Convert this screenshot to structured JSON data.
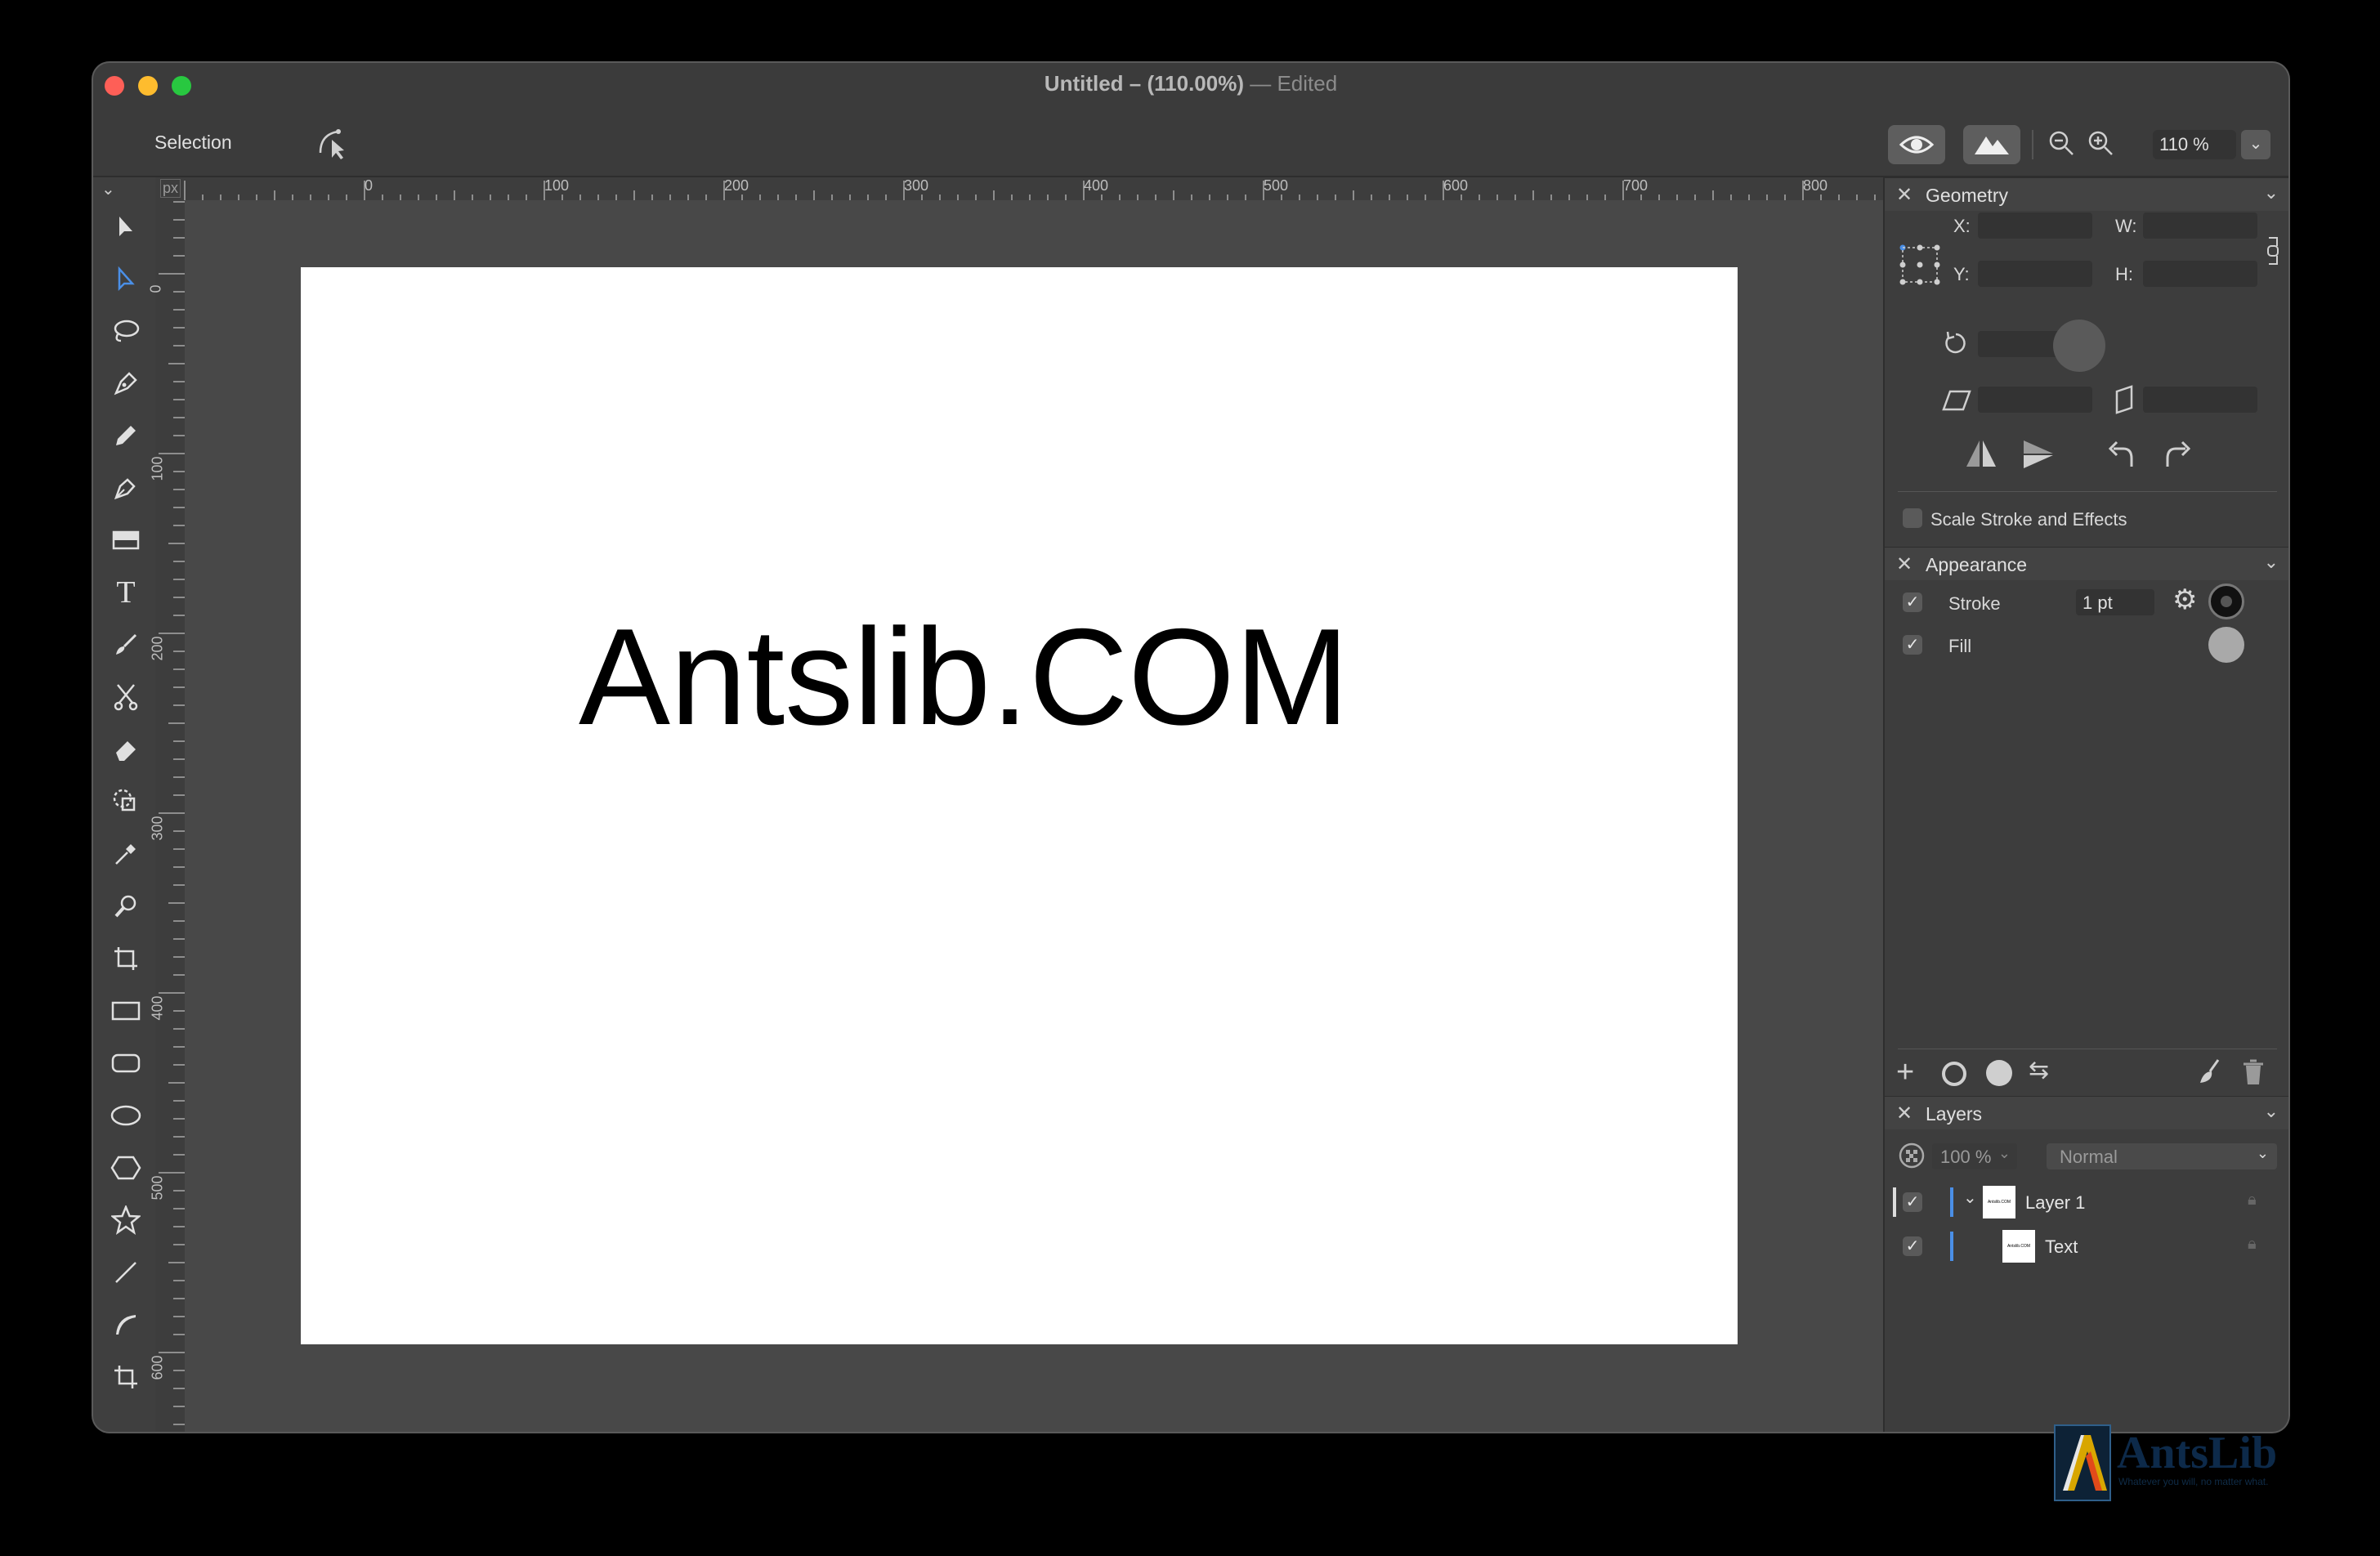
{
  "window": {
    "title": "Untitled – (110.00%)",
    "edited": "— Edited"
  },
  "toolbar": {
    "tool_name": "Selection",
    "zoom": "110 %"
  },
  "ruler": {
    "unit": "px",
    "h_ticks": [
      "0",
      "100",
      "200",
      "300",
      "400",
      "500",
      "600",
      "700",
      "800"
    ],
    "v_ticks": [
      "0",
      "100",
      "200",
      "300",
      "400",
      "500",
      "600"
    ]
  },
  "canvas": {
    "text": "Antslib.COM"
  },
  "geometry": {
    "title": "Geometry",
    "x_label": "X:",
    "y_label": "Y:",
    "w_label": "W:",
    "h_label": "H:",
    "scale_label": "Scale Stroke and Effects"
  },
  "appearance": {
    "title": "Appearance",
    "stroke_label": "Stroke",
    "stroke_width": "1 pt",
    "fill_label": "Fill"
  },
  "layers": {
    "title": "Layers",
    "opacity": "100 %",
    "blend_mode": "Normal",
    "items": [
      {
        "name": "Layer 1"
      },
      {
        "name": "Text"
      }
    ]
  },
  "watermark": {
    "brand": "AntsLib",
    "tagline": "Whatever you will, no matter what."
  }
}
